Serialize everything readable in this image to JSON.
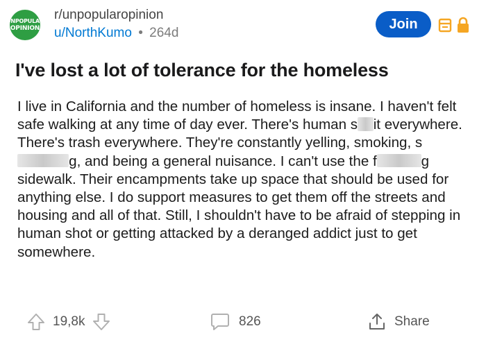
{
  "community": {
    "avatar_line1": "UNPOPULAR",
    "avatar_line2": "OPINION",
    "name": "r/unpopularopinion"
  },
  "author": {
    "username": "u/NorthKumo",
    "separator": "•",
    "age": "264d"
  },
  "header": {
    "join_label": "Join"
  },
  "post": {
    "title": "I've lost a lot of tolerance for the homeless",
    "body": {
      "p1": "I live in California and the number of homeless is insane. I haven't felt safe walking at any time of day ever. There's human s",
      "p2": "it everywhere. There's trash everywhere. They're constantly yelling, smoking, s",
      "p3": "g, and being a general nuisance. I can't use the f",
      "p4": "g sidewalk. Their encampments take up space that should be used for anything else. I do support measures to get them off the streets and housing and all of that. Still, I shouldn't have to be afraid of stepping in human shot or getting attacked by a deranged addict just to get somewhere."
    }
  },
  "actions": {
    "upvotes": "19,8k",
    "comments": "826",
    "share_label": "Share"
  },
  "colors": {
    "accent": "#0a5dc7",
    "link": "#0079d3",
    "badge_orange": "#f5a623",
    "avatar_green": "#2e9e43"
  },
  "icons": {
    "mod_icon": "calendar-badge-icon",
    "lock_icon": "lock-icon",
    "upvote_icon": "arrow-up-icon",
    "downvote_icon": "arrow-down-icon",
    "comment_icon": "speech-bubble-icon",
    "share_icon": "share-icon"
  }
}
